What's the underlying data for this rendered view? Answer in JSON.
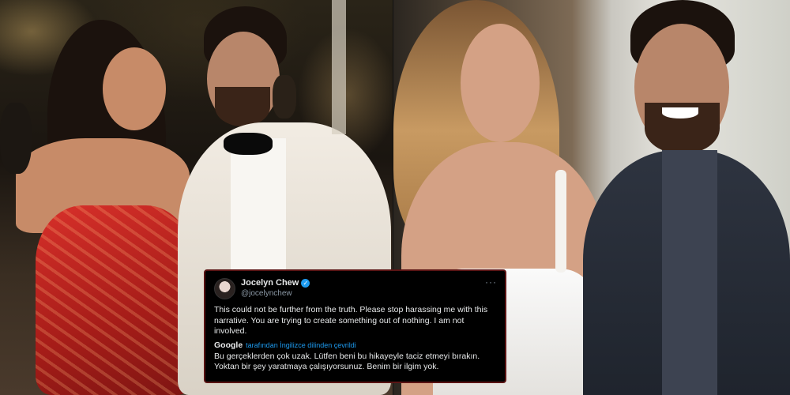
{
  "tweet": {
    "author_name": "Jocelyn Chew",
    "handle": "@jocelynchew",
    "text": "This could not be further from the truth. Please stop harassing me with this narrative. You are trying to create something out of nothing. I am not involved.",
    "translation_provider": "Google",
    "translation_note": "tarafından İngilizce dilinden çevrildi",
    "translated_text": "Bu gerçeklerden çok uzak. Lütfen beni bu hikayeyle taciz etmeyi bırakın. Yoktan bir şey yaratmaya çalışıyorsunuz. Benim bir ilgim yok.",
    "more_icon": "more-horizontal-icon",
    "verified_icon": "verified-badge-icon"
  },
  "colors": {
    "card_background": "#000000",
    "card_border": "#5a1414",
    "link_blue": "#1d9bf0",
    "secondary_text": "#8b98a5"
  }
}
